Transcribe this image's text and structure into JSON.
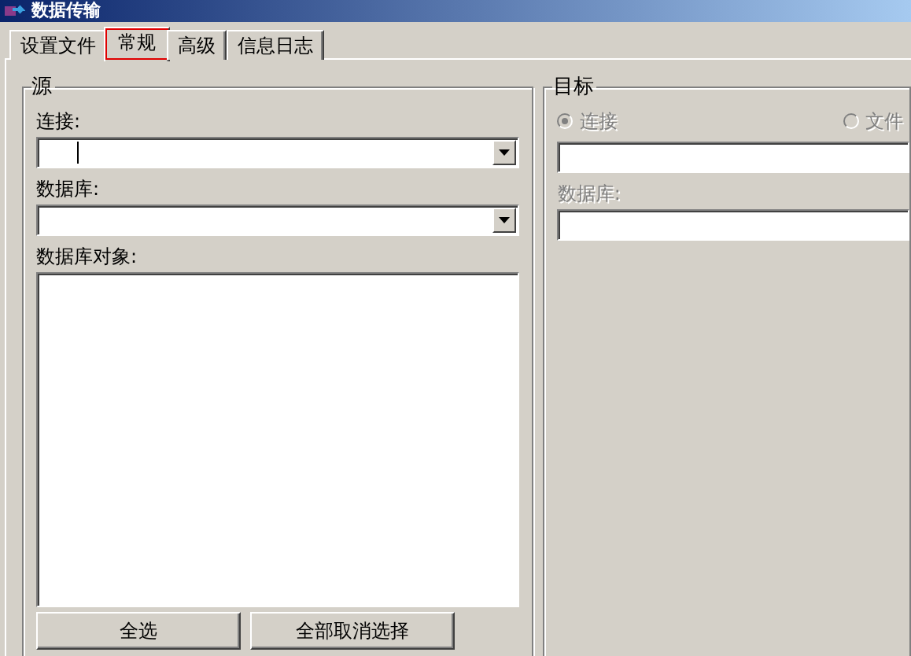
{
  "window": {
    "title": "数据传输"
  },
  "tabs": [
    {
      "label": "设置文件",
      "selected": false,
      "highlighted": false
    },
    {
      "label": "常规",
      "selected": true,
      "highlighted": true
    },
    {
      "label": "高级",
      "selected": false,
      "highlighted": false
    },
    {
      "label": "信息日志",
      "selected": false,
      "highlighted": false
    }
  ],
  "source": {
    "title": "源",
    "connection_label": "连接:",
    "database_label": "数据库:",
    "objects_label": "数据库对象:",
    "buttons": [
      "全选",
      "全部取消选择"
    ]
  },
  "target": {
    "title": "目标",
    "options": [
      {
        "label": "连接",
        "selected": true,
        "disabled": true
      },
      {
        "label": "文件",
        "selected": false,
        "disabled": true
      }
    ],
    "database_label": "数据库:"
  }
}
